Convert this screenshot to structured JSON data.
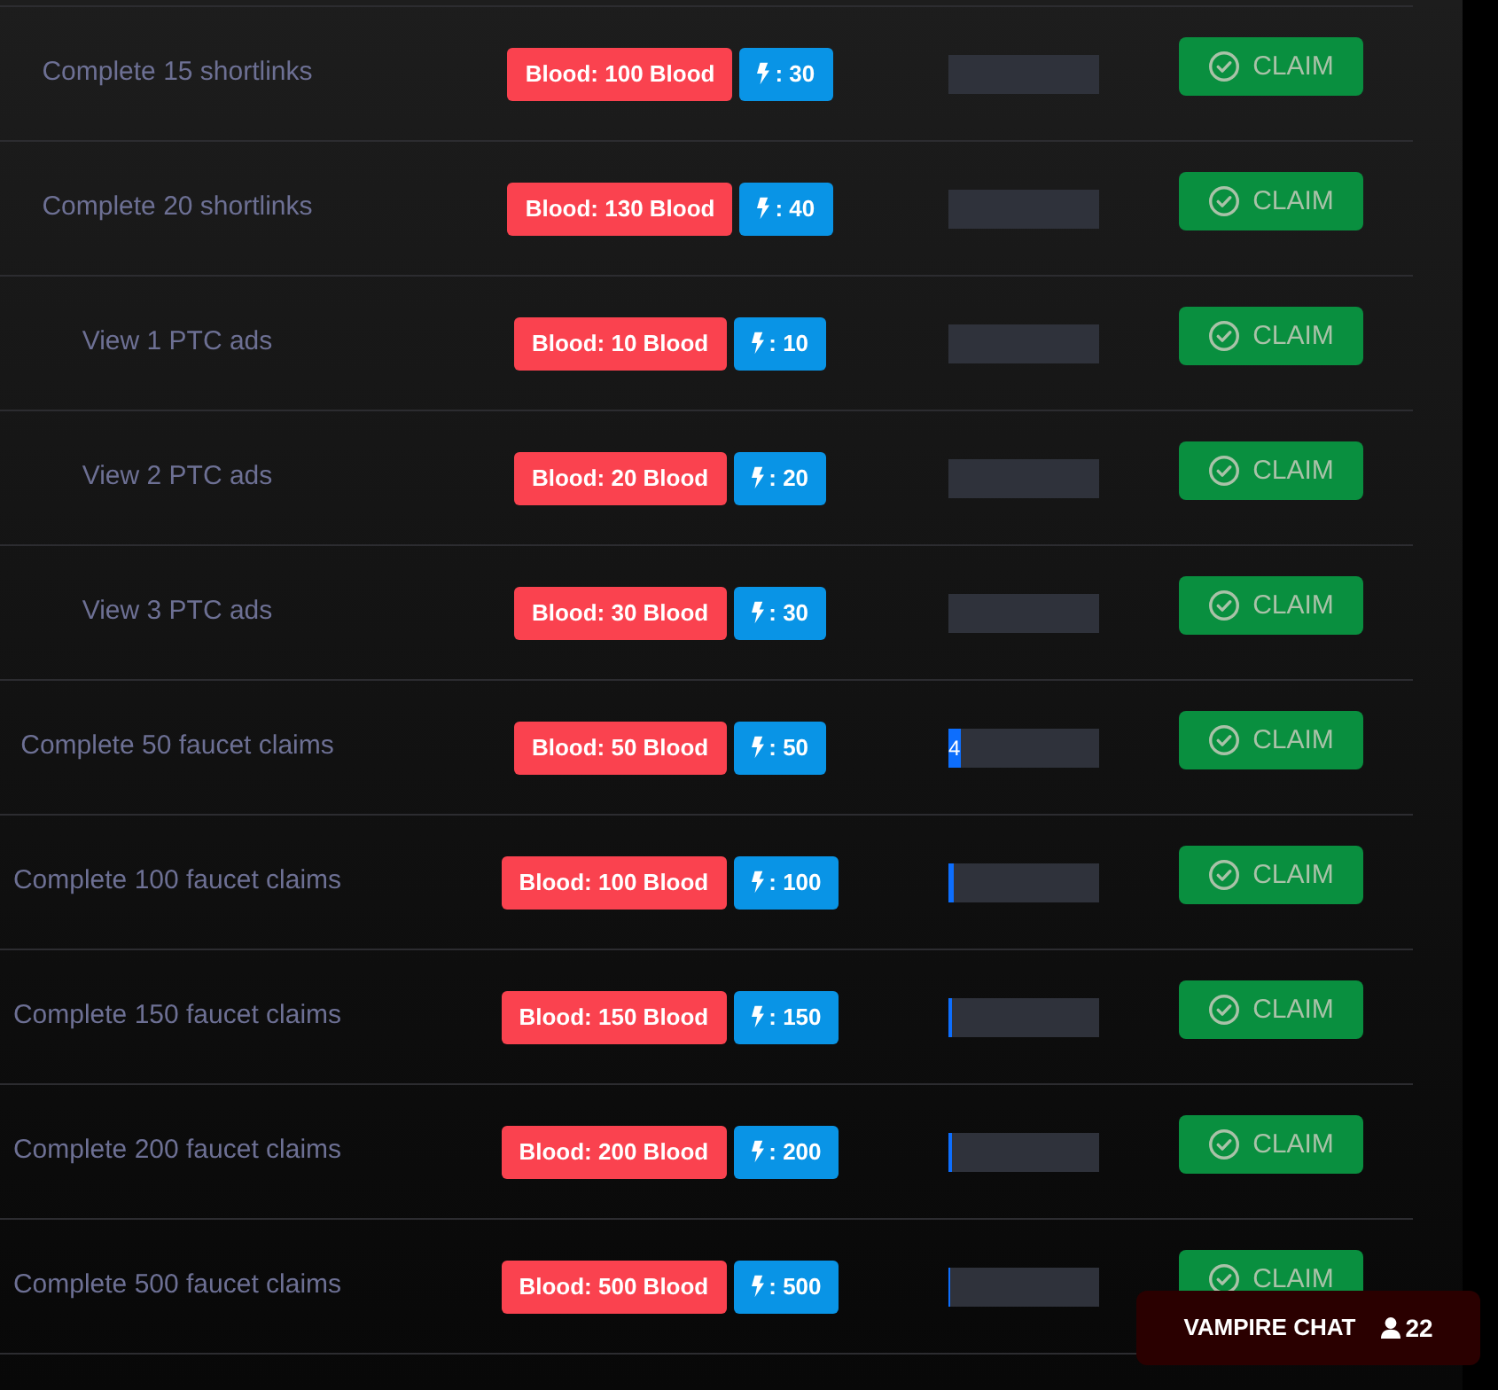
{
  "tasks": [
    {
      "label": "Complete 15 shortlinks",
      "reward": "Blood: 100 Blood",
      "energy": ": 30",
      "button": "CLAIM"
    },
    {
      "label": "Complete 20 shortlinks",
      "reward": "Blood: 130 Blood",
      "energy": ": 40",
      "button": "CLAIM"
    },
    {
      "label": "View 1 PTC ads",
      "reward": "Blood: 10 Blood",
      "energy": ": 10",
      "button": "CLAIM"
    },
    {
      "label": "View 2 PTC ads",
      "reward": "Blood: 20 Blood",
      "energy": ": 20",
      "button": "CLAIM"
    },
    {
      "label": "View 3 PTC ads",
      "reward": "Blood: 30 Blood",
      "energy": ": 30",
      "button": "CLAIM"
    },
    {
      "label": "Complete 50 faucet claims",
      "reward": "Blood: 50 Blood",
      "energy": ": 50",
      "progress": {
        "level": 0.08,
        "label": "4"
      },
      "button": "CLAIM"
    },
    {
      "label": "Complete 100 faucet claims",
      "reward": "Blood: 100 Blood",
      "energy": ": 100",
      "progress": {
        "level": 0.04
      },
      "button": "CLAIM"
    },
    {
      "label": "Complete 150 faucet claims",
      "reward": "Blood: 150 Blood",
      "energy": ": 150",
      "progress": {
        "level": 0.027
      },
      "button": "CLAIM"
    },
    {
      "label": "Complete 200 faucet claims",
      "reward": "Blood: 200 Blood",
      "energy": ": 200",
      "progress": {
        "level": 0.02
      },
      "button": "CLAIM"
    },
    {
      "label": "Complete 500 faucet claims",
      "reward": "Blood: 500 Blood",
      "energy": ": 500",
      "progress": {
        "level": 0.008
      },
      "button": "CLAIM"
    }
  ],
  "chat": {
    "title": "VAMPIRE CHAT",
    "count": "22"
  }
}
